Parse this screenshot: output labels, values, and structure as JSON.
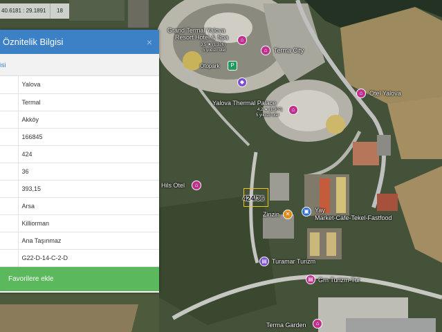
{
  "coords": {
    "text": "40.6181 : 29.1891",
    "zoom": "18"
  },
  "panel": {
    "title": "Öznitelik Bilgisi",
    "close": "×",
    "subheader": "isi",
    "rows": [
      {
        "value": "Yalova"
      },
      {
        "value": "Termal"
      },
      {
        "value": "Akköy"
      },
      {
        "value": "166845"
      },
      {
        "value": "424"
      },
      {
        "value": "36"
      },
      {
        "value": "393,15"
      },
      {
        "value": "Arsa"
      },
      {
        "value": "Killiorman"
      },
      {
        "value": "Ana Taşınmaz"
      },
      {
        "value": "G22-D-14-C-2-D"
      }
    ],
    "favorite_button": "Favorilere ekle"
  },
  "map": {
    "parcel_label": "424/36",
    "labels": {
      "grand_termal_1": "Grand Termal Yalova",
      "grand_termal_2": "Resort Hotel & Spa",
      "grand_termal_rating": "3,5 ★ (1.326)",
      "grand_termal_stars": "5 yıldızlı otel",
      "terma_city": "Terma City",
      "otoprk": "Otopark",
      "thermal_palace": "Yalova Thermal Palace",
      "thermal_palace_rating": "4,2 ★ (1.907)",
      "thermal_palace_stars": "5 yıldızlı otel",
      "otel_yalova": "Otel Yalova",
      "hils_otel": "Hils Otel",
      "zinzin": "Zinzin",
      "yay_market": "Yay",
      "yay_market_2": "Market-Cafe-Tekel-Fastfood",
      "turamar": "Turamar Turizm",
      "grn_turizm": "Grn Turizm-Tur",
      "terma_garden": "Terma Garden"
    }
  }
}
